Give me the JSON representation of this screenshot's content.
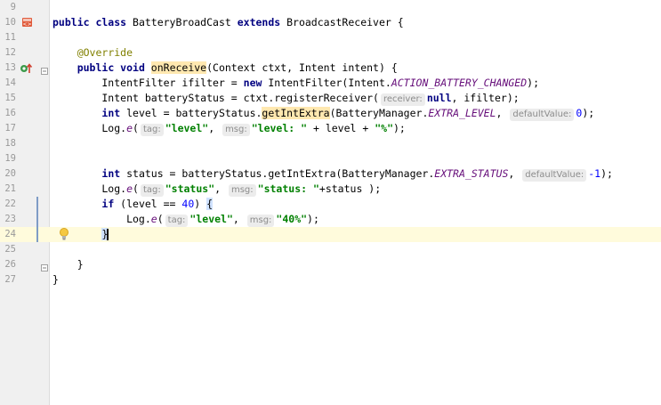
{
  "editor": {
    "lines": [
      {
        "num": "9",
        "tokens": []
      },
      {
        "num": "10",
        "gutter_icon": "class-icon",
        "tokens": [
          {
            "t": "public class ",
            "c": "kw"
          },
          {
            "t": "BatteryBroadCast "
          },
          {
            "t": "extends ",
            "c": "kw"
          },
          {
            "t": "BroadcastReceiver {"
          }
        ]
      },
      {
        "num": "11",
        "tokens": []
      },
      {
        "num": "12",
        "tokens": [
          {
            "t": "    "
          },
          {
            "t": "@Override",
            "c": "ann"
          }
        ]
      },
      {
        "num": "13",
        "gutter_icon": "override-icon",
        "fold": true,
        "tokens": [
          {
            "t": "    "
          },
          {
            "t": "public void ",
            "c": "kw"
          },
          {
            "t": "onReceive",
            "c": "sel"
          },
          {
            "t": "(Context ctxt, Intent intent) {"
          }
        ]
      },
      {
        "num": "14",
        "tokens": [
          {
            "t": "        IntentFilter ifilter = "
          },
          {
            "t": "new ",
            "c": "kw"
          },
          {
            "t": "IntentFilter(Intent."
          },
          {
            "t": "ACTION_BATTERY_CHANGED",
            "c": "const"
          },
          {
            "t": ");"
          }
        ]
      },
      {
        "num": "15",
        "tokens": [
          {
            "t": "        Intent batteryStatus = ctxt.registerReceiver("
          },
          {
            "t": "receiver:",
            "c": "hint"
          },
          {
            "t": "null",
            "c": "kw"
          },
          {
            "t": ", ifilter);"
          }
        ]
      },
      {
        "num": "16",
        "tokens": [
          {
            "t": "        "
          },
          {
            "t": "int ",
            "c": "kw"
          },
          {
            "t": "level = batteryStatus."
          },
          {
            "t": "getIntExtra",
            "c": "sel"
          },
          {
            "t": "(BatteryManager."
          },
          {
            "t": "EXTRA_LEVEL",
            "c": "const"
          },
          {
            "t": ", "
          },
          {
            "t": "defaultValue:",
            "c": "hint"
          },
          {
            "t": "0",
            "c": "num"
          },
          {
            "t": ");"
          }
        ]
      },
      {
        "num": "17",
        "tokens": [
          {
            "t": "        Log."
          },
          {
            "t": "e",
            "c": "const"
          },
          {
            "t": "("
          },
          {
            "t": "tag:",
            "c": "hint"
          },
          {
            "t": "\"level\"",
            "c": "str"
          },
          {
            "t": ", "
          },
          {
            "t": "msg:",
            "c": "hint"
          },
          {
            "t": "\"level: \"",
            "c": "str"
          },
          {
            "t": " + level + "
          },
          {
            "t": "\"%\"",
            "c": "str"
          },
          {
            "t": ");"
          }
        ]
      },
      {
        "num": "18",
        "tokens": []
      },
      {
        "num": "19",
        "tokens": []
      },
      {
        "num": "20",
        "tokens": [
          {
            "t": "        "
          },
          {
            "t": "int ",
            "c": "kw"
          },
          {
            "t": "status = batteryStatus.getIntExtra(BatteryManager."
          },
          {
            "t": "EXTRA_STATUS",
            "c": "const"
          },
          {
            "t": ", "
          },
          {
            "t": "defaultValue:",
            "c": "hint"
          },
          {
            "t": "-1",
            "c": "num"
          },
          {
            "t": ");"
          }
        ]
      },
      {
        "num": "21",
        "tokens": [
          {
            "t": "        Log."
          },
          {
            "t": "e",
            "c": "const"
          },
          {
            "t": "("
          },
          {
            "t": "tag:",
            "c": "hint"
          },
          {
            "t": "\"status\"",
            "c": "str"
          },
          {
            "t": ", "
          },
          {
            "t": "msg:",
            "c": "hint"
          },
          {
            "t": "\"status: \"",
            "c": "str"
          },
          {
            "t": "+status );"
          }
        ]
      },
      {
        "num": "22",
        "changed": true,
        "tokens": [
          {
            "t": "        "
          },
          {
            "t": "if ",
            "c": "kw"
          },
          {
            "t": "(level == "
          },
          {
            "t": "40",
            "c": "num"
          },
          {
            "t": ") "
          },
          {
            "t": "{",
            "c": "brace-hl"
          }
        ]
      },
      {
        "num": "23",
        "changed": true,
        "tokens": [
          {
            "t": "            Log."
          },
          {
            "t": "e",
            "c": "const"
          },
          {
            "t": "("
          },
          {
            "t": "tag:",
            "c": "hint"
          },
          {
            "t": "\"level\"",
            "c": "str"
          },
          {
            "t": ", "
          },
          {
            "t": "msg:",
            "c": "hint"
          },
          {
            "t": "\"40%\"",
            "c": "str"
          },
          {
            "t": ");"
          }
        ]
      },
      {
        "num": "24",
        "current": true,
        "bulb": true,
        "changed": true,
        "tokens": [
          {
            "t": "        "
          },
          {
            "t": "}",
            "c": "brace-hl"
          },
          {
            "t": "",
            "c": "caret"
          }
        ]
      },
      {
        "num": "25",
        "tokens": []
      },
      {
        "num": "26",
        "fold": true,
        "tokens": [
          {
            "t": "    }"
          }
        ]
      },
      {
        "num": "27",
        "tokens": [
          {
            "t": "}"
          }
        ]
      }
    ]
  }
}
